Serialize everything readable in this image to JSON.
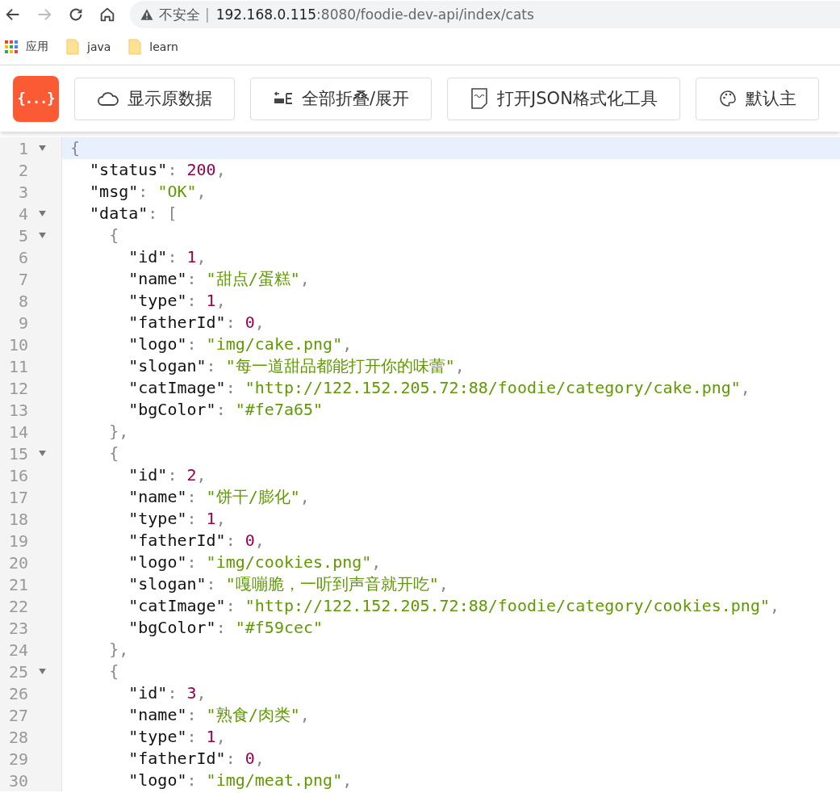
{
  "browser": {
    "url_warning": "不安全",
    "url_separator": "|",
    "url_host": "192.168.0.115",
    "url_rest": ":8080/foodie-dev-api/index/cats"
  },
  "bookmarks": [
    {
      "kind": "apps",
      "label": "应用"
    },
    {
      "kind": "folder",
      "label": "java"
    },
    {
      "kind": "folder",
      "label": "learn"
    }
  ],
  "toolbar": {
    "logo": "{...}",
    "buttons": [
      {
        "kind": "cloud",
        "label": "显示原数据"
      },
      {
        "kind": "fold",
        "label": "全部折叠/展开"
      },
      {
        "kind": "json",
        "label": "打开JSON格式化工具"
      },
      {
        "kind": "palette",
        "label": "默认主"
      }
    ]
  },
  "lines": [
    {
      "number": "1",
      "foldable": true,
      "active": true,
      "tokens": [
        {
          "kind": "punct",
          "text": "{"
        }
      ]
    },
    {
      "number": "2",
      "foldable": false,
      "active": false,
      "tokens": [
        {
          "kind": "key",
          "text": "  \"status\""
        },
        {
          "kind": "punct",
          "text": ": "
        },
        {
          "kind": "number",
          "text": "200"
        },
        {
          "kind": "punct",
          "text": ","
        }
      ]
    },
    {
      "number": "3",
      "foldable": false,
      "active": false,
      "tokens": [
        {
          "kind": "key",
          "text": "  \"msg\""
        },
        {
          "kind": "punct",
          "text": ": "
        },
        {
          "kind": "string",
          "text": "\"OK\""
        },
        {
          "kind": "punct",
          "text": ","
        }
      ]
    },
    {
      "number": "4",
      "foldable": true,
      "active": false,
      "tokens": [
        {
          "kind": "key",
          "text": "  \"data\""
        },
        {
          "kind": "punct",
          "text": ": ["
        }
      ]
    },
    {
      "number": "5",
      "foldable": true,
      "active": false,
      "tokens": [
        {
          "kind": "punct",
          "text": "    {"
        }
      ]
    },
    {
      "number": "6",
      "foldable": false,
      "active": false,
      "tokens": [
        {
          "kind": "key",
          "text": "      \"id\""
        },
        {
          "kind": "punct",
          "text": ": "
        },
        {
          "kind": "number",
          "text": "1"
        },
        {
          "kind": "punct",
          "text": ","
        }
      ]
    },
    {
      "number": "7",
      "foldable": false,
      "active": false,
      "tokens": [
        {
          "kind": "key",
          "text": "      \"name\""
        },
        {
          "kind": "punct",
          "text": ": "
        },
        {
          "kind": "string",
          "text": "\"甜点/蛋糕\""
        },
        {
          "kind": "punct",
          "text": ","
        }
      ]
    },
    {
      "number": "8",
      "foldable": false,
      "active": false,
      "tokens": [
        {
          "kind": "key",
          "text": "      \"type\""
        },
        {
          "kind": "punct",
          "text": ": "
        },
        {
          "kind": "number",
          "text": "1"
        },
        {
          "kind": "punct",
          "text": ","
        }
      ]
    },
    {
      "number": "9",
      "foldable": false,
      "active": false,
      "tokens": [
        {
          "kind": "key",
          "text": "      \"fatherId\""
        },
        {
          "kind": "punct",
          "text": ": "
        },
        {
          "kind": "number",
          "text": "0"
        },
        {
          "kind": "punct",
          "text": ","
        }
      ]
    },
    {
      "number": "10",
      "foldable": false,
      "active": false,
      "tokens": [
        {
          "kind": "key",
          "text": "      \"logo\""
        },
        {
          "kind": "punct",
          "text": ": "
        },
        {
          "kind": "string",
          "text": "\"img/cake.png\""
        },
        {
          "kind": "punct",
          "text": ","
        }
      ]
    },
    {
      "number": "11",
      "foldable": false,
      "active": false,
      "tokens": [
        {
          "kind": "key",
          "text": "      \"slogan\""
        },
        {
          "kind": "punct",
          "text": ": "
        },
        {
          "kind": "string",
          "text": "\"每一道甜品都能打开你的味蕾\""
        },
        {
          "kind": "punct",
          "text": ","
        }
      ]
    },
    {
      "number": "12",
      "foldable": false,
      "active": false,
      "tokens": [
        {
          "kind": "key",
          "text": "      \"catImage\""
        },
        {
          "kind": "punct",
          "text": ": "
        },
        {
          "kind": "string",
          "text": "\"http://122.152.205.72:88/foodie/category/cake.png\""
        },
        {
          "kind": "punct",
          "text": ","
        }
      ]
    },
    {
      "number": "13",
      "foldable": false,
      "active": false,
      "tokens": [
        {
          "kind": "key",
          "text": "      \"bgColor\""
        },
        {
          "kind": "punct",
          "text": ": "
        },
        {
          "kind": "string",
          "text": "\"#fe7a65\""
        }
      ]
    },
    {
      "number": "14",
      "foldable": false,
      "active": false,
      "tokens": [
        {
          "kind": "punct",
          "text": "    },"
        }
      ]
    },
    {
      "number": "15",
      "foldable": true,
      "active": false,
      "tokens": [
        {
          "kind": "punct",
          "text": "    {"
        }
      ]
    },
    {
      "number": "16",
      "foldable": false,
      "active": false,
      "tokens": [
        {
          "kind": "key",
          "text": "      \"id\""
        },
        {
          "kind": "punct",
          "text": ": "
        },
        {
          "kind": "number",
          "text": "2"
        },
        {
          "kind": "punct",
          "text": ","
        }
      ]
    },
    {
      "number": "17",
      "foldable": false,
      "active": false,
      "tokens": [
        {
          "kind": "key",
          "text": "      \"name\""
        },
        {
          "kind": "punct",
          "text": ": "
        },
        {
          "kind": "string",
          "text": "\"饼干/膨化\""
        },
        {
          "kind": "punct",
          "text": ","
        }
      ]
    },
    {
      "number": "18",
      "foldable": false,
      "active": false,
      "tokens": [
        {
          "kind": "key",
          "text": "      \"type\""
        },
        {
          "kind": "punct",
          "text": ": "
        },
        {
          "kind": "number",
          "text": "1"
        },
        {
          "kind": "punct",
          "text": ","
        }
      ]
    },
    {
      "number": "19",
      "foldable": false,
      "active": false,
      "tokens": [
        {
          "kind": "key",
          "text": "      \"fatherId\""
        },
        {
          "kind": "punct",
          "text": ": "
        },
        {
          "kind": "number",
          "text": "0"
        },
        {
          "kind": "punct",
          "text": ","
        }
      ]
    },
    {
      "number": "20",
      "foldable": false,
      "active": false,
      "tokens": [
        {
          "kind": "key",
          "text": "      \"logo\""
        },
        {
          "kind": "punct",
          "text": ": "
        },
        {
          "kind": "string",
          "text": "\"img/cookies.png\""
        },
        {
          "kind": "punct",
          "text": ","
        }
      ]
    },
    {
      "number": "21",
      "foldable": false,
      "active": false,
      "tokens": [
        {
          "kind": "key",
          "text": "      \"slogan\""
        },
        {
          "kind": "punct",
          "text": ": "
        },
        {
          "kind": "string",
          "text": "\"嘎嘣脆，一听到声音就开吃\""
        },
        {
          "kind": "punct",
          "text": ","
        }
      ]
    },
    {
      "number": "22",
      "foldable": false,
      "active": false,
      "tokens": [
        {
          "kind": "key",
          "text": "      \"catImage\""
        },
        {
          "kind": "punct",
          "text": ": "
        },
        {
          "kind": "string",
          "text": "\"http://122.152.205.72:88/foodie/category/cookies.png\""
        },
        {
          "kind": "punct",
          "text": ","
        }
      ]
    },
    {
      "number": "23",
      "foldable": false,
      "active": false,
      "tokens": [
        {
          "kind": "key",
          "text": "      \"bgColor\""
        },
        {
          "kind": "punct",
          "text": ": "
        },
        {
          "kind": "string",
          "text": "\"#f59cec\""
        }
      ]
    },
    {
      "number": "24",
      "foldable": false,
      "active": false,
      "tokens": [
        {
          "kind": "punct",
          "text": "    },"
        }
      ]
    },
    {
      "number": "25",
      "foldable": true,
      "active": false,
      "tokens": [
        {
          "kind": "punct",
          "text": "    {"
        }
      ]
    },
    {
      "number": "26",
      "foldable": false,
      "active": false,
      "tokens": [
        {
          "kind": "key",
          "text": "      \"id\""
        },
        {
          "kind": "punct",
          "text": ": "
        },
        {
          "kind": "number",
          "text": "3"
        },
        {
          "kind": "punct",
          "text": ","
        }
      ]
    },
    {
      "number": "27",
      "foldable": false,
      "active": false,
      "tokens": [
        {
          "kind": "key",
          "text": "      \"name\""
        },
        {
          "kind": "punct",
          "text": ": "
        },
        {
          "kind": "string",
          "text": "\"熟食/肉类\""
        },
        {
          "kind": "punct",
          "text": ","
        }
      ]
    },
    {
      "number": "28",
      "foldable": false,
      "active": false,
      "tokens": [
        {
          "kind": "key",
          "text": "      \"type\""
        },
        {
          "kind": "punct",
          "text": ": "
        },
        {
          "kind": "number",
          "text": "1"
        },
        {
          "kind": "punct",
          "text": ","
        }
      ]
    },
    {
      "number": "29",
      "foldable": false,
      "active": false,
      "tokens": [
        {
          "kind": "key",
          "text": "      \"fatherId\""
        },
        {
          "kind": "punct",
          "text": ": "
        },
        {
          "kind": "number",
          "text": "0"
        },
        {
          "kind": "punct",
          "text": ","
        }
      ]
    },
    {
      "number": "30",
      "foldable": false,
      "active": false,
      "tokens": [
        {
          "kind": "key",
          "text": "      \"logo\""
        },
        {
          "kind": "punct",
          "text": ": "
        },
        {
          "kind": "string",
          "text": "\"img/meat.png\""
        },
        {
          "kind": "punct",
          "text": ","
        }
      ]
    }
  ]
}
